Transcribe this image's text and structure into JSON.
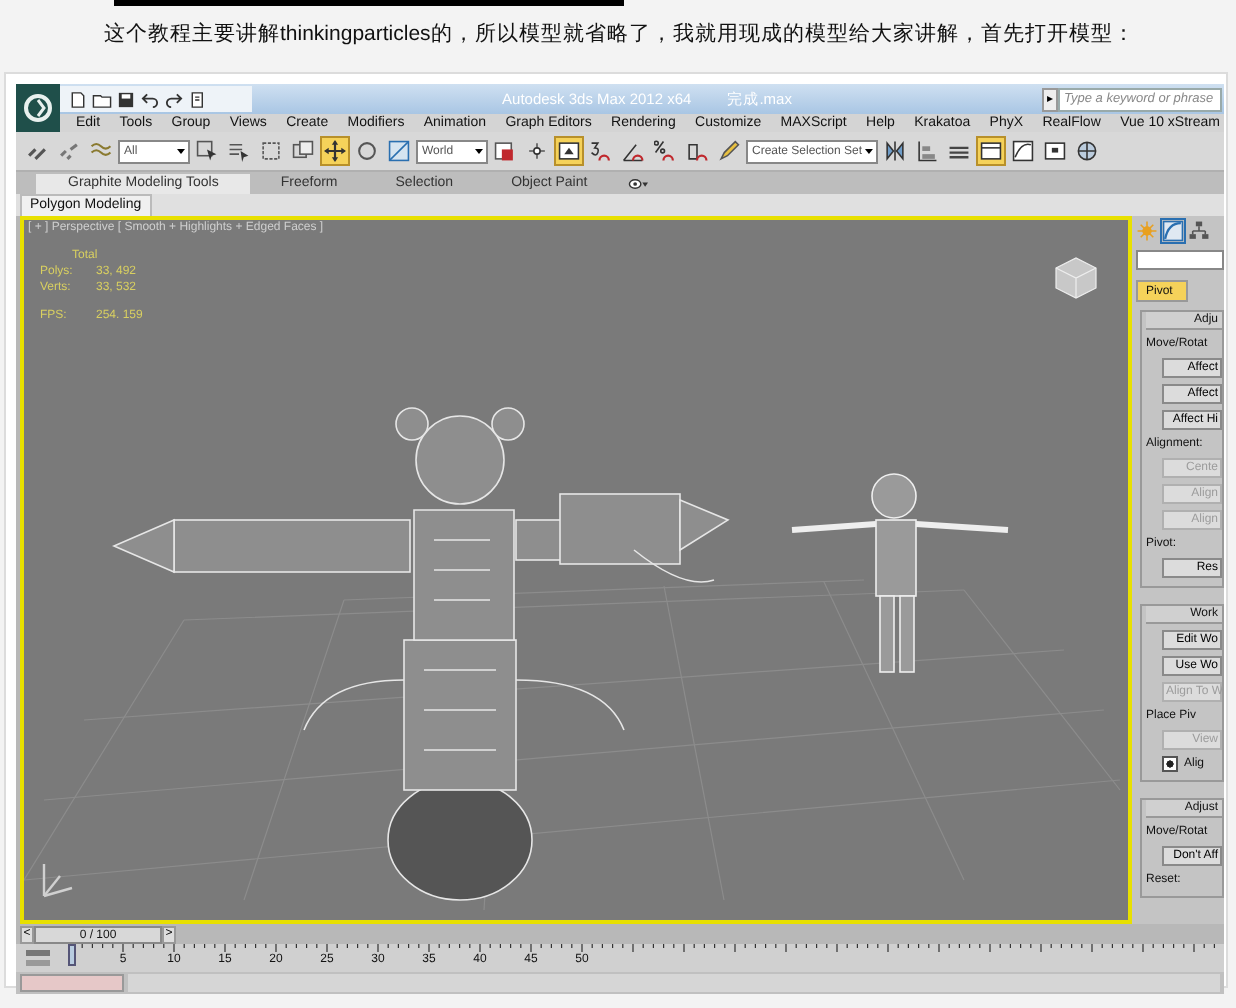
{
  "caption": "这个教程主要讲解thinkingparticles的，所以模型就省略了，我就用现成的模型给大家讲解，首先打开模型：",
  "window": {
    "title": "Autodesk 3ds Max  2012 x64",
    "file": "完成.max",
    "search_button": "▸",
    "search": {
      "placeholder": "Type a keyword or phrase"
    }
  },
  "menu": [
    "Edit",
    "Tools",
    "Group",
    "Views",
    "Create",
    "Modifiers",
    "Animation",
    "Graph Editors",
    "Rendering",
    "Customize",
    "MAXScript",
    "Help",
    "Krakatoa",
    "PhyX",
    "RealFlow",
    "Vue 10 xStream"
  ],
  "main_toolbar": [
    {
      "kind": "tool",
      "selected": false
    },
    {
      "kind": "tool",
      "selected": false
    },
    {
      "kind": "tool",
      "selected": false
    },
    {
      "kind": "dropdown",
      "value": "All"
    },
    {
      "kind": "tool",
      "selected": false
    },
    {
      "kind": "tool",
      "selected": false
    },
    {
      "kind": "tool",
      "selected": false
    },
    {
      "kind": "tool",
      "selected": false
    },
    {
      "kind": "tool",
      "selected": true
    },
    {
      "kind": "tool",
      "selected": false
    },
    {
      "kind": "tool",
      "selected": false
    },
    {
      "kind": "dropdown",
      "value": "World"
    },
    {
      "kind": "tool",
      "selected": false
    },
    {
      "kind": "tool",
      "selected": false
    },
    {
      "kind": "tool",
      "selected": true
    },
    {
      "kind": "tool",
      "selected": false
    },
    {
      "kind": "tool",
      "selected": false
    },
    {
      "kind": "tool",
      "selected": false
    },
    {
      "kind": "tool",
      "selected": false
    },
    {
      "kind": "tool",
      "selected": false
    },
    {
      "kind": "dropdown",
      "value": "Create Selection Set"
    },
    {
      "kind": "tool",
      "selected": false
    },
    {
      "kind": "tool",
      "selected": false
    },
    {
      "kind": "tool",
      "selected": false
    },
    {
      "kind": "tool",
      "selected": true
    },
    {
      "kind": "tool",
      "selected": false
    },
    {
      "kind": "tool",
      "selected": false
    },
    {
      "kind": "tool",
      "selected": false
    }
  ],
  "ribbon": {
    "tabs": [
      {
        "label": "Graphite Modeling Tools",
        "selected": true
      },
      {
        "label": "Freeform",
        "selected": false
      },
      {
        "label": "Selection",
        "selected": false
      },
      {
        "label": "Object Paint",
        "selected": false
      }
    ],
    "panel": "Polygon Modeling"
  },
  "viewport": {
    "label": "[ + ] Perspective [ Smooth + Highlights + Edged Faces ]",
    "stats_title": "Total",
    "stats": [
      {
        "label": "Polys:",
        "value": "33, 492"
      },
      {
        "label": "Verts:",
        "value": "33, 532"
      },
      {
        "label": "FPS:",
        "value": "254. 159"
      }
    ]
  },
  "command_panel": {
    "tab": {
      "label": "Pivot",
      "selected": true
    },
    "rollouts": [
      {
        "title": "Adju",
        "items": [
          {
            "kind": "group",
            "label": "Move/Rotat"
          },
          {
            "kind": "button",
            "label": "Affect",
            "disabled": false
          },
          {
            "kind": "button",
            "label": "Affect",
            "disabled": false
          },
          {
            "kind": "button",
            "label": "Affect Hi",
            "disabled": false
          },
          {
            "kind": "group",
            "label": "Alignment:"
          },
          {
            "kind": "button",
            "label": "Cente",
            "disabled": true
          },
          {
            "kind": "button",
            "label": "Align",
            "disabled": true
          },
          {
            "kind": "button",
            "label": "Align",
            "disabled": true
          },
          {
            "kind": "group",
            "label": "Pivot:"
          },
          {
            "kind": "button",
            "label": "Res",
            "disabled": false
          }
        ]
      },
      {
        "title": "Work",
        "items": [
          {
            "kind": "button",
            "label": "Edit Wo",
            "disabled": false
          },
          {
            "kind": "button",
            "label": "Use Wo",
            "disabled": false
          },
          {
            "kind": "button",
            "label": "Align To W",
            "disabled": true
          },
          {
            "kind": "group",
            "label": "Place Piv"
          },
          {
            "kind": "button",
            "label": "View",
            "disabled": true
          },
          {
            "kind": "checkbox",
            "label": "Alig",
            "checked": true
          }
        ]
      },
      {
        "title": "Adjust",
        "items": [
          {
            "kind": "group",
            "label": "Move/Rotat"
          },
          {
            "kind": "button",
            "label": "Don't Aff",
            "disabled": false
          },
          {
            "kind": "group",
            "label": "Reset:"
          }
        ]
      }
    ]
  },
  "time_slider": {
    "prev": "<",
    "value": "0 / 100",
    "next": ">"
  },
  "track_bar": {
    "labels": [
      "5",
      "10",
      "15",
      "20",
      "25",
      "30",
      "35",
      "40",
      "45",
      "50"
    ]
  }
}
